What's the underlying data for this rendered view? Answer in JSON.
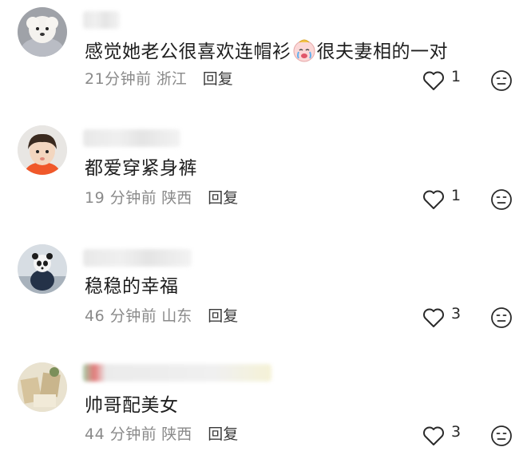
{
  "comments": [
    {
      "avatar": "white-poodle-dog-photo",
      "text_before_emoji": "感觉她老公很喜欢连帽衫",
      "emoji": "crying-face-emoji",
      "text_after_emoji": "很夫妻相的一对",
      "time": "21分钟前",
      "location": "浙江",
      "reply_label": "回复",
      "likes": "1"
    },
    {
      "avatar": "toddler-orange-shirt-photo",
      "text_before_emoji": "都爱穿紧身裤",
      "emoji": "",
      "text_after_emoji": "",
      "time": "19 分钟前",
      "location": "陕西",
      "reply_label": "回复",
      "likes": "1"
    },
    {
      "avatar": "panda-figure-photo",
      "text_before_emoji": "稳稳的幸福",
      "emoji": "",
      "text_after_emoji": "",
      "time": "46 分钟前",
      "location": "山东",
      "reply_label": "回复",
      "likes": "3"
    },
    {
      "avatar": "beige-photo-collage",
      "text_before_emoji": "帅哥配美女",
      "emoji": "",
      "text_after_emoji": "",
      "time": "44 分钟前",
      "location": "陕西",
      "reply_label": "回复",
      "likes": "3"
    }
  ],
  "icons": {
    "like": "heart-outline-icon",
    "dislike": "neutral-face-icon"
  },
  "colors": {
    "text": "#1e1e1e",
    "meta": "#8a8a8a",
    "reply": "#3a3a3a",
    "icon": "#2a2a2a"
  }
}
